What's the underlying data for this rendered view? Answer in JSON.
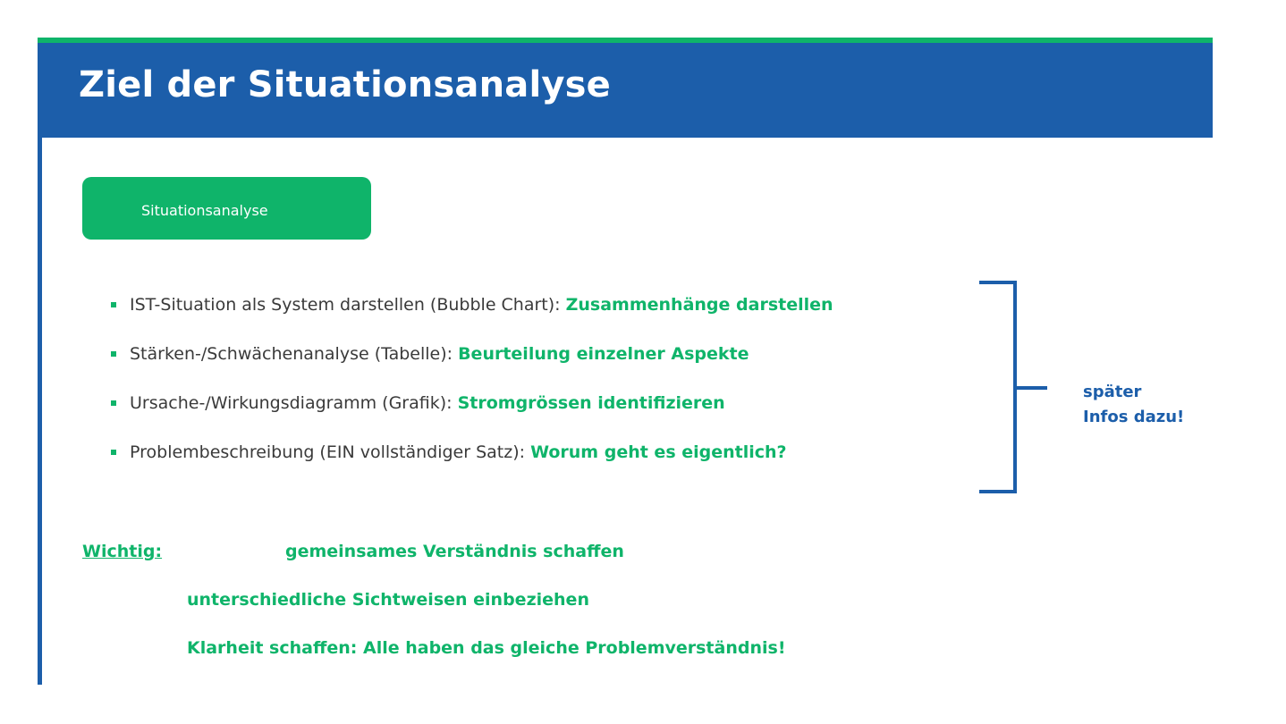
{
  "slide": {
    "title": "Ziel der Situationsanalyse",
    "badge_label": "Situationsanalyse"
  },
  "bullets": [
    {
      "text": "IST-Situation als System darstellen (Bubble Chart): ",
      "highlight": "Zusammenhänge darstellen"
    },
    {
      "text": "Stärken-/Schwächenanalyse (Tabelle): ",
      "highlight": "Beurteilung einzelner Aspekte"
    },
    {
      "text": "Ursache-/Wirkungsdiagramm (Grafik): ",
      "highlight": "Stromgrössen identifizieren"
    },
    {
      "text": "Problembeschreibung (EIN vollständiger Satz): ",
      "highlight": "Worum geht es eigentlich?"
    }
  ],
  "bracket_note": "später Infos dazu!",
  "important": {
    "label": "Wichtig: ",
    "lines": [
      "gemeinsames Verständnis schaffen",
      "unterschiedliche Sichtweisen einbeziehen",
      "Klarheit schaffen: Alle haben das gleiche Problemverständnis!"
    ]
  },
  "colors": {
    "header_blue": "#1c5eaa",
    "accent_green": "#0fb46a",
    "body_text": "#3a3a3a"
  }
}
